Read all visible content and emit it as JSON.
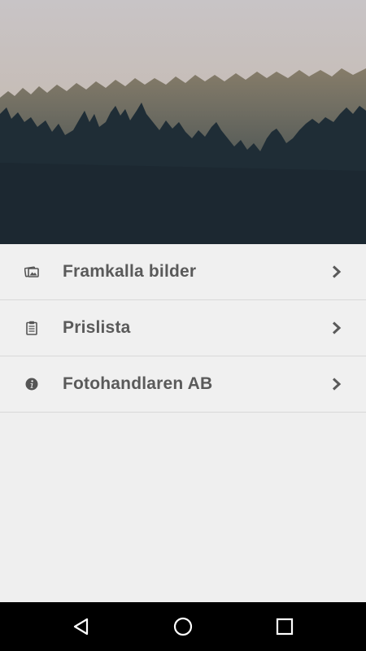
{
  "hero": {
    "image_icon": "forest-mist-landscape"
  },
  "menu": {
    "items": [
      {
        "label": "Framkalla bilder",
        "icon": "photos-icon"
      },
      {
        "label": "Prislista",
        "icon": "clipboard-icon"
      },
      {
        "label": "Fotohandlaren AB",
        "icon": "info-icon"
      }
    ]
  },
  "navbar": {
    "back_icon": "back-triangle-icon",
    "home_icon": "home-circle-icon",
    "recents_icon": "recents-square-icon"
  },
  "colors": {
    "background": "#efefef",
    "label": "#5a5a5a",
    "icon": "#555555",
    "divider": "#d8d8d8",
    "navbar": "#000000"
  }
}
